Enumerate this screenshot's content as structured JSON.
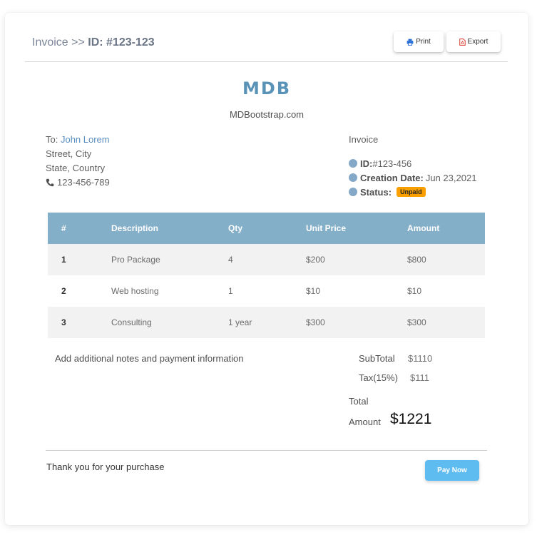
{
  "header": {
    "breadcrumb_prefix": "Invoice >> ",
    "breadcrumb_id": "ID: #123-123",
    "print_label": "Print",
    "export_label": "Export"
  },
  "brand": {
    "logo_text": "MDB",
    "site": "MDBootstrap.com"
  },
  "billing": {
    "to_label": "To: ",
    "name": "John Lorem",
    "street": "Street, City",
    "state": "State, Country",
    "phone": "123-456-789"
  },
  "invoice_info": {
    "title": "Invoice",
    "id_label": "ID:",
    "id_value": "#123-456",
    "date_label": "Creation Date:",
    "date_value": "Jun 23,2021",
    "status_label": "Status:",
    "status_value": "Unpaid"
  },
  "table": {
    "headers": [
      "#",
      "Description",
      "Qty",
      "Unit Price",
      "Amount"
    ],
    "rows": [
      [
        "1",
        "Pro Package",
        "4",
        "$200",
        "$800"
      ],
      [
        "2",
        "Web hosting",
        "1",
        "$10",
        "$10"
      ],
      [
        "3",
        "Consulting",
        "1 year",
        "$300",
        "$300"
      ]
    ]
  },
  "notes": "Add additional notes and payment information",
  "totals": {
    "subtotal_label": "SubTotal",
    "subtotal_value": "$1110",
    "tax_label": "Tax(15%)",
    "tax_value": "$111",
    "total_label_line1": "Total",
    "total_label_line2": "Amount",
    "total_value": "$1221"
  },
  "footer": {
    "thanks": "Thank you for your purchase",
    "pay_label": "Pay Now"
  },
  "colors": {
    "accent": "#84afc9",
    "status_badge": "#f9a000",
    "pay_button": "#5fbcf0",
    "link": "#5a8fc0"
  }
}
